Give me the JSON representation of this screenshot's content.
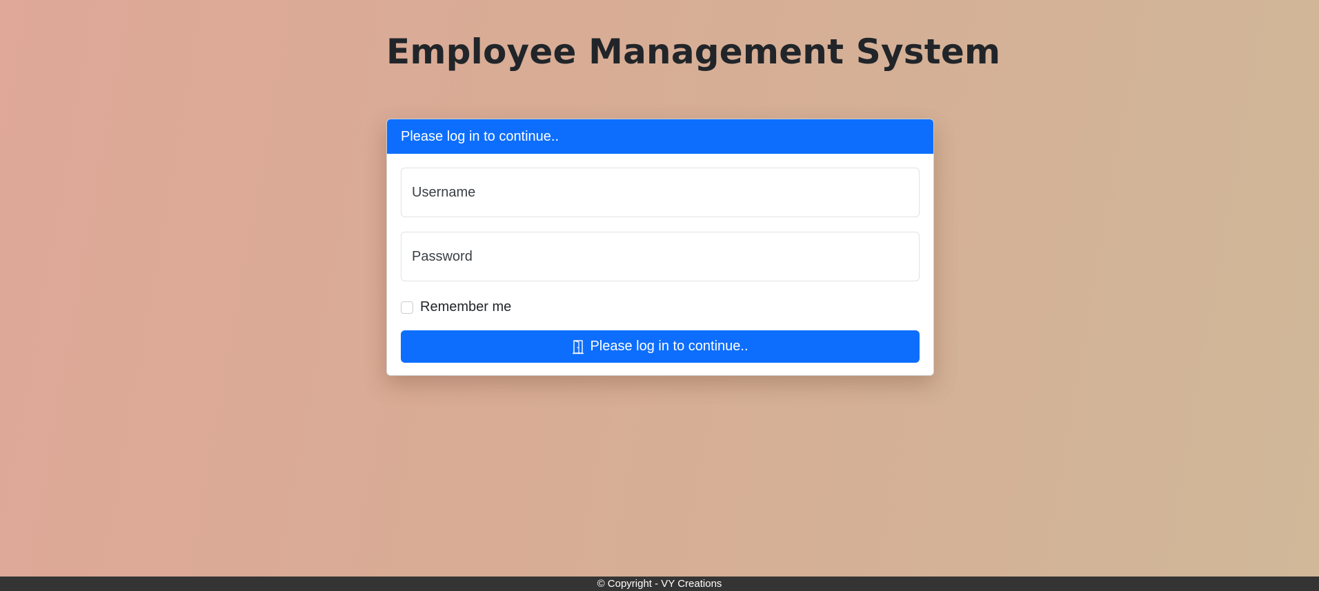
{
  "header": {
    "title": "Employee Management System"
  },
  "login_card": {
    "header_text": "Please log in to continue..",
    "username": {
      "placeholder": "Username",
      "value": ""
    },
    "password": {
      "placeholder": "Password",
      "value": ""
    },
    "remember_me": {
      "label": "Remember me",
      "checked": false
    },
    "submit": {
      "label": "Please log in to continue..",
      "icon": "door-icon"
    }
  },
  "footer": {
    "text": "© Copyright - VY Creations"
  },
  "colors": {
    "primary": "#0d6efd",
    "footer_bg": "#343434",
    "text": "#212529"
  }
}
